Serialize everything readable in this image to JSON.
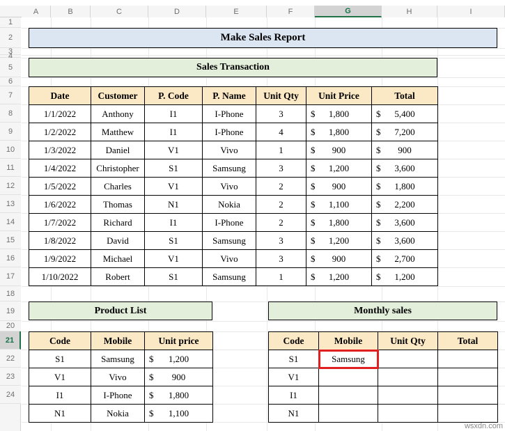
{
  "spreadsheet": {
    "active_cell_column": "G",
    "active_row": "21",
    "columns": [
      "A",
      "B",
      "C",
      "D",
      "E",
      "F",
      "G",
      "H",
      "I"
    ],
    "rows": [
      "1",
      "2",
      "3",
      "4",
      "5",
      "6",
      "7",
      "8",
      "9",
      "10",
      "11",
      "12",
      "13",
      "14",
      "15",
      "16",
      "17",
      "18",
      "19",
      "20",
      "21",
      "22",
      "23",
      "24"
    ],
    "watermark": "wsxdn.com"
  },
  "colors": {
    "title_main_fill": "#dce6f2",
    "title_section_fill": "#e3efdb",
    "table_header_fill": "#fbe8c4",
    "highlight_border": "#e02020",
    "active_header": "#15724b"
  },
  "titles": {
    "main": "Make Sales Report",
    "sales_transaction": "Sales Transaction",
    "product_list": "Product List",
    "monthly_sales": "Monthly sales"
  },
  "sales_transaction": {
    "headers": [
      "Date",
      "Customer",
      "P. Code",
      "P. Name",
      "Unit Qty",
      "Unit Price",
      "Total"
    ],
    "currency_symbol": "$",
    "rows": [
      {
        "date": "1/1/2022",
        "customer": "Anthony",
        "p_code": "I1",
        "p_name": "I-Phone",
        "qty": "3",
        "unit_price": "1,800",
        "total": "5,400"
      },
      {
        "date": "1/2/2022",
        "customer": "Matthew",
        "p_code": "I1",
        "p_name": "I-Phone",
        "qty": "4",
        "unit_price": "1,800",
        "total": "7,200"
      },
      {
        "date": "1/3/2022",
        "customer": "Daniel",
        "p_code": "V1",
        "p_name": "Vivo",
        "qty": "1",
        "unit_price": "900",
        "total": "900"
      },
      {
        "date": "1/4/2022",
        "customer": "Christopher",
        "p_code": "S1",
        "p_name": "Samsung",
        "qty": "3",
        "unit_price": "1,200",
        "total": "3,600"
      },
      {
        "date": "1/5/2022",
        "customer": "Charles",
        "p_code": "V1",
        "p_name": "Vivo",
        "qty": "2",
        "unit_price": "900",
        "total": "1,800"
      },
      {
        "date": "1/6/2022",
        "customer": "Thomas",
        "p_code": "N1",
        "p_name": "Nokia",
        "qty": "2",
        "unit_price": "1,100",
        "total": "2,200"
      },
      {
        "date": "1/7/2022",
        "customer": "Richard",
        "p_code": "I1",
        "p_name": "I-Phone",
        "qty": "2",
        "unit_price": "1,800",
        "total": "3,600"
      },
      {
        "date": "1/8/2022",
        "customer": "David",
        "p_code": "S1",
        "p_name": "Samsung",
        "qty": "3",
        "unit_price": "1,200",
        "total": "3,600"
      },
      {
        "date": "1/9/2022",
        "customer": "Michael",
        "p_code": "V1",
        "p_name": "Vivo",
        "qty": "3",
        "unit_price": "900",
        "total": "2,700"
      },
      {
        "date": "1/10/2022",
        "customer": "Robert",
        "p_code": "S1",
        "p_name": "Samsung",
        "qty": "1",
        "unit_price": "1,200",
        "total": "1,200"
      }
    ]
  },
  "product_list": {
    "headers": [
      "Code",
      "Mobile",
      "Unit price"
    ],
    "currency_symbol": "$",
    "rows": [
      {
        "code": "S1",
        "mobile": "Samsung",
        "unit_price": "1,200"
      },
      {
        "code": "V1",
        "mobile": "Vivo",
        "unit_price": "900"
      },
      {
        "code": "I1",
        "mobile": "I-Phone",
        "unit_price": "1,800"
      },
      {
        "code": "N1",
        "mobile": "Nokia",
        "unit_price": "1,100"
      }
    ]
  },
  "monthly_sales": {
    "headers": [
      "Code",
      "Mobile",
      "Unit Qty",
      "Total"
    ],
    "rows": [
      {
        "code": "S1",
        "mobile": "Samsung",
        "qty": "",
        "total": "",
        "highlight": true
      },
      {
        "code": "V1",
        "mobile": "",
        "qty": "",
        "total": "",
        "highlight": false
      },
      {
        "code": "I1",
        "mobile": "",
        "qty": "",
        "total": "",
        "highlight": false
      },
      {
        "code": "N1",
        "mobile": "",
        "qty": "",
        "total": "",
        "highlight": false
      }
    ]
  }
}
